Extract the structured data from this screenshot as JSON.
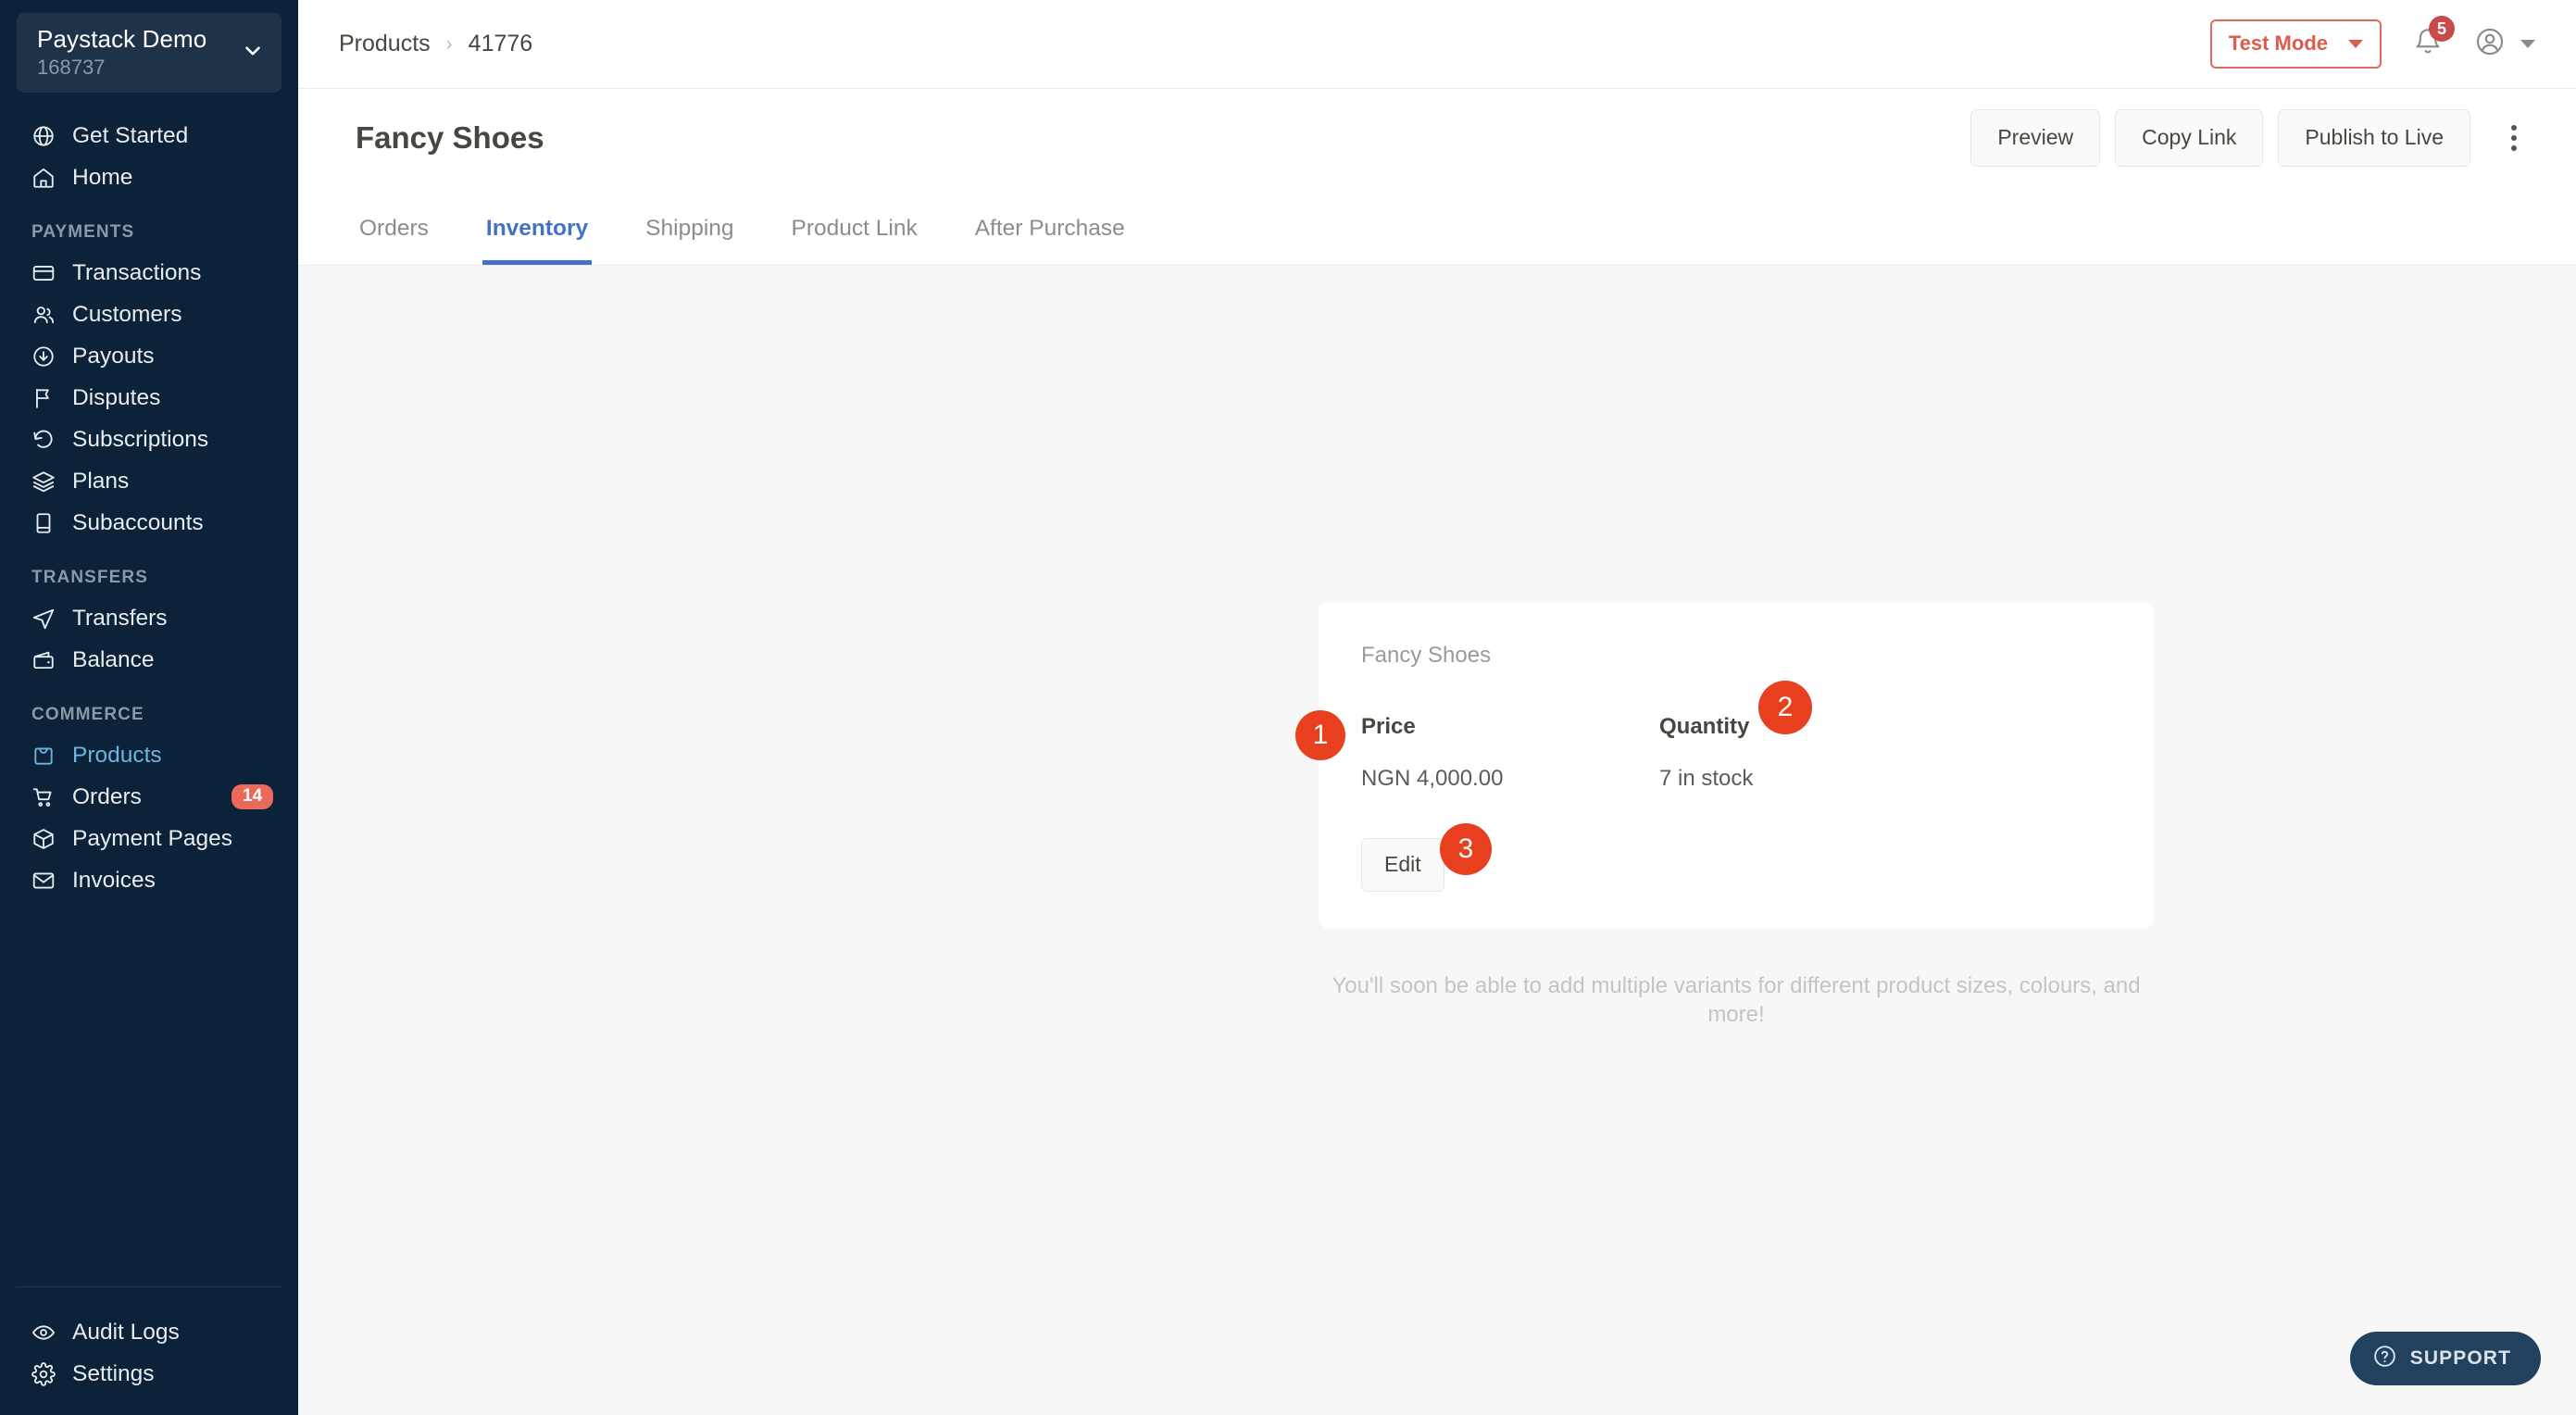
{
  "sidebar": {
    "org": {
      "name": "Paystack Demo",
      "id": "168737",
      "chevron_icon": "chevron-down-icon"
    },
    "top_items": [
      {
        "label": "Get Started",
        "icon": "globe-icon"
      },
      {
        "label": "Home",
        "icon": "home-icon"
      }
    ],
    "sections": [
      {
        "title": "PAYMENTS",
        "items": [
          {
            "label": "Transactions",
            "icon": "card-icon"
          },
          {
            "label": "Customers",
            "icon": "users-icon"
          },
          {
            "label": "Payouts",
            "icon": "download-circle-icon"
          },
          {
            "label": "Disputes",
            "icon": "flag-icon"
          },
          {
            "label": "Subscriptions",
            "icon": "refresh-icon"
          },
          {
            "label": "Plans",
            "icon": "layers-icon"
          },
          {
            "label": "Subaccounts",
            "icon": "book-icon"
          }
        ]
      },
      {
        "title": "TRANSFERS",
        "items": [
          {
            "label": "Transfers",
            "icon": "send-icon"
          },
          {
            "label": "Balance",
            "icon": "wallet-icon"
          }
        ]
      },
      {
        "title": "COMMERCE",
        "items": [
          {
            "label": "Products",
            "icon": "shopping-bag-icon",
            "active": true
          },
          {
            "label": "Orders",
            "icon": "cart-icon",
            "badge": "14"
          },
          {
            "label": "Payment Pages",
            "icon": "box-icon"
          },
          {
            "label": "Invoices",
            "icon": "mail-icon"
          }
        ]
      }
    ],
    "footer_items": [
      {
        "label": "Audit Logs",
        "icon": "eye-icon"
      },
      {
        "label": "Settings",
        "icon": "gear-icon"
      }
    ],
    "colors": {
      "background": "#0C2238",
      "active": "#6FB4DE",
      "badge": "#E96A5B"
    }
  },
  "topbar": {
    "breadcrumb": {
      "root": "Products",
      "separator": "›",
      "current": "41776"
    },
    "test_mode_label": "Test Mode",
    "notification_count": "5",
    "bell_icon": "bell-icon",
    "avatar_icon": "user-avatar-icon",
    "colors": {
      "test_mode": "#DE5C4E",
      "bell_badge": "#C94A4A"
    }
  },
  "page": {
    "title": "Fancy Shoes",
    "actions": {
      "preview": "Preview",
      "copy_link": "Copy Link",
      "publish": "Publish to Live",
      "more_icon": "kebab-menu-icon"
    },
    "tabs": [
      {
        "label": "Orders",
        "active": false
      },
      {
        "label": "Inventory",
        "active": true
      },
      {
        "label": "Shipping",
        "active": false
      },
      {
        "label": "Product Link",
        "active": false
      },
      {
        "label": "After Purchase",
        "active": false
      }
    ],
    "tab_active_color": "#4372C4"
  },
  "variant_card": {
    "name": "Fancy Shoes",
    "price_label": "Price",
    "price_value": "NGN 4,000.00",
    "quantity_label": "Quantity",
    "quantity_value": "7 in stock",
    "edit_label": "Edit"
  },
  "hint_text": "You'll soon be able to add multiple variants for different product sizes, colours, and more!",
  "markers": [
    {
      "number": "1"
    },
    {
      "number": "2"
    },
    {
      "number": "3"
    }
  ],
  "marker_color": "#E8401F",
  "support": {
    "label": "SUPPORT",
    "icon": "question-circle-icon"
  }
}
